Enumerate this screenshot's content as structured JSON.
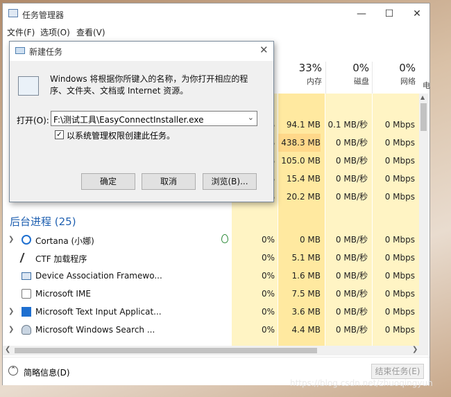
{
  "window": {
    "title": "任务管理器",
    "controls": [
      "—",
      "☐",
      "✕"
    ]
  },
  "menu": {
    "file": "文件(F)",
    "options": "选项(O)",
    "view": "查看(V)"
  },
  "columns": {
    "memory": {
      "pct": "33%",
      "label": "内存"
    },
    "disk": {
      "pct": "0%",
      "label": "磁盘"
    },
    "network": {
      "pct": "0%",
      "label": "网络"
    },
    "power_partial": "电"
  },
  "apps_rows": [
    {
      "cpu": "%",
      "mem": "94.1 MB",
      "disk": "0.1 MB/秒",
      "net": "0 Mbps"
    },
    {
      "cpu": "%",
      "mem": "438.3 MB",
      "disk": "0 MB/秒",
      "net": "0 Mbps"
    },
    {
      "cpu": "%",
      "mem": "105.0 MB",
      "disk": "0 MB/秒",
      "net": "0 Mbps"
    },
    {
      "cpu": "%",
      "mem": "15.4 MB",
      "disk": "0 MB/秒",
      "net": "0 Mbps"
    },
    {
      "cpu": "%",
      "mem": "20.2 MB",
      "disk": "0 MB/秒",
      "net": "0 Mbps"
    }
  ],
  "background_section": "后台进程 (25)",
  "processes": [
    {
      "name": "Cortana (小娜)",
      "cpu": "0%",
      "mem": "0 MB",
      "disk": "0 MB/秒",
      "net": "0 Mbps",
      "expand": true,
      "icon": "cortana-icon"
    },
    {
      "name": "CTF 加载程序",
      "cpu": "0%",
      "mem": "5.1 MB",
      "disk": "0 MB/秒",
      "net": "0 Mbps",
      "expand": false,
      "icon": "ctf-icon"
    },
    {
      "name": "Device Association Framewo...",
      "cpu": "0%",
      "mem": "1.6 MB",
      "disk": "0 MB/秒",
      "net": "0 Mbps",
      "expand": false,
      "icon": "device-icon"
    },
    {
      "name": "Microsoft IME",
      "cpu": "0%",
      "mem": "7.5 MB",
      "disk": "0 MB/秒",
      "net": "0 Mbps",
      "expand": false,
      "icon": "ime-icon"
    },
    {
      "name": "Microsoft Text Input Applicat...",
      "cpu": "0%",
      "mem": "3.6 MB",
      "disk": "0 MB/秒",
      "net": "0 Mbps",
      "expand": true,
      "icon": "text-input-icon"
    },
    {
      "name": "Microsoft Windows Search ...",
      "cpu": "0%",
      "mem": "4.4 MB",
      "disk": "0 MB/秒",
      "net": "0 Mbps",
      "expand": true,
      "icon": "search-user-icon"
    }
  ],
  "footer": {
    "less_details": "简略信息(D)",
    "end_task": "结束任务(E)"
  },
  "dialog": {
    "title": "新建任务",
    "description": "Windows 将根据你所键入的名称，为你打开相应的程序、文件夹、文档或 Internet 资源。",
    "open_label": "打开(O):",
    "open_value": "F:\\测试工具\\EasyConnectInstaller.exe",
    "admin_checkbox": "以系统管理权限创建此任务。",
    "admin_checked": true,
    "ok": "确定",
    "cancel": "取消",
    "browse": "浏览(B)..."
  },
  "watermark": "https://blog.csdn.net/zhuoqingyun"
}
